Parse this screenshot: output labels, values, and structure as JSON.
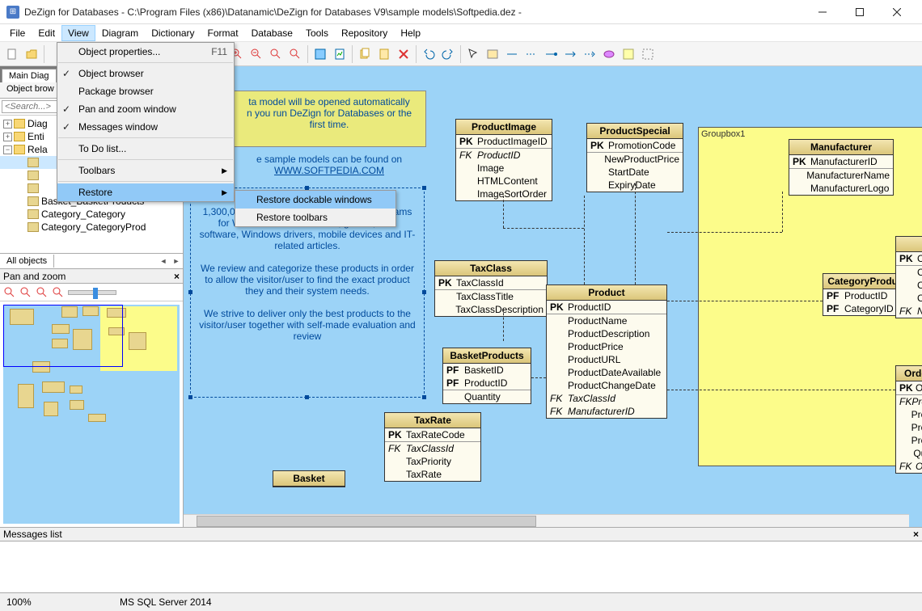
{
  "window": {
    "title": "DeZign for Databases - C:\\Program Files (x86)\\Datanamic\\DeZign for Databases V9\\sample models\\Softpedia.dez -"
  },
  "menubar": [
    "File",
    "Edit",
    "View",
    "Diagram",
    "Dictionary",
    "Format",
    "Database",
    "Tools",
    "Repository",
    "Help"
  ],
  "view_menu": {
    "object_properties": "Object properties...",
    "object_properties_key": "F11",
    "object_browser": "Object browser",
    "package_browser": "Package browser",
    "pan_zoom": "Pan and zoom window",
    "messages": "Messages window",
    "todo": "To Do list...",
    "toolbars": "Toolbars",
    "restore": "Restore"
  },
  "restore_submenu": {
    "dockable": "Restore dockable windows",
    "toolbars": "Restore toolbars"
  },
  "left": {
    "main_tab": "Main Diag",
    "object_browser_tab": "Object brow",
    "search_placeholder": "<Search...>",
    "tree": {
      "diagrams": "Diag",
      "entities": "Enti",
      "relationships": "Rela",
      "basket_products": "Basket_BasketProducts",
      "category_category": "Category_Category",
      "category_categoryprod": "Category_CategoryProd"
    },
    "all_objects": "All objects",
    "panzoom_title": "Pan and zoom"
  },
  "canvas": {
    "groupbox_label": "Groupbox1",
    "note_text": "ta model will be opened automatically\nn you run DeZign for Databases or the\nfirst time.",
    "note2_line1": "e sample models can be found on",
    "note2_line2": "WWW.SOFTPEDIA.COM",
    "desc_text": "Sof\n1,300,000 free and free-to-try software programs for Windows and Unix/Linux, games, Mac software, Windows drivers, mobile devices and IT-related articles.\n\nWe review and categorize these products in order to allow the visitor/user to find the exact product they and their system needs.\n\nWe strive to deliver only the best products to the visitor/user together with self-made evaluation and review",
    "entities": {
      "ProductImage": {
        "title": "ProductImage",
        "rows": [
          [
            "PK",
            "ProductImageID",
            ""
          ],
          [
            "FK",
            "ProductID",
            "i"
          ],
          [
            "",
            "Image",
            ""
          ],
          [
            "",
            "HTMLContent",
            ""
          ],
          [
            "",
            "ImageSortOrder",
            ""
          ]
        ]
      },
      "ProductSpecial": {
        "title": "ProductSpecial",
        "rows": [
          [
            "PK",
            "PromotionCode",
            ""
          ],
          [
            "",
            "NewProductPrice",
            ""
          ],
          [
            "",
            "StartDate",
            ""
          ],
          [
            "",
            "ExpiryDate",
            ""
          ]
        ]
      },
      "Manufacturer": {
        "title": "Manufacturer",
        "rows": [
          [
            "PK",
            "ManufacturerID",
            ""
          ],
          [
            "",
            "ManufacturerName",
            ""
          ],
          [
            "",
            "ManufacturerLogo",
            ""
          ]
        ]
      },
      "TaxClass": {
        "title": "TaxClass",
        "rows": [
          [
            "PK",
            "TaxClassId",
            ""
          ],
          [
            "",
            "TaxClassTitle",
            ""
          ],
          [
            "",
            "TaxClassDescription",
            ""
          ]
        ]
      },
      "Product": {
        "title": "Product",
        "rows": [
          [
            "PK",
            "ProductID",
            ""
          ],
          [
            "",
            "ProductName",
            ""
          ],
          [
            "",
            "ProductDescription",
            ""
          ],
          [
            "",
            "ProductPrice",
            ""
          ],
          [
            "",
            "ProductURL",
            ""
          ],
          [
            "",
            "ProductDateAvailable",
            ""
          ],
          [
            "",
            "ProductChangeDate",
            ""
          ],
          [
            "FK",
            "TaxClassId",
            "i"
          ],
          [
            "FK",
            "ManufacturerID",
            "i"
          ]
        ]
      },
      "CategoryProduct": {
        "title": "CategoryProduct",
        "rows": [
          [
            "PF",
            "ProductID",
            ""
          ],
          [
            "PF",
            "CategoryID",
            ""
          ]
        ]
      },
      "BasketProducts": {
        "title": "BasketProducts",
        "rows": [
          [
            "PF",
            "BasketID",
            ""
          ],
          [
            "PF",
            "ProductID",
            ""
          ],
          [
            "",
            "Quantity",
            ""
          ]
        ]
      },
      "TaxRate": {
        "title": "TaxRate",
        "rows": [
          [
            "PK",
            "TaxRateCode",
            ""
          ],
          [
            "FK",
            "TaxClassId",
            "i"
          ],
          [
            "",
            "TaxPriority",
            ""
          ],
          [
            "",
            "TaxRate",
            ""
          ]
        ]
      },
      "PartialRight": {
        "title": "",
        "rows": [
          [
            "PK",
            "C",
            ""
          ],
          [
            "",
            "C",
            ""
          ],
          [
            "",
            "C",
            ""
          ],
          [
            "",
            "C",
            ""
          ],
          [
            "FK",
            "N",
            ""
          ]
        ]
      },
      "Order": {
        "title": "Orde",
        "rows": [
          [
            "PK",
            "Ord",
            ""
          ],
          [
            "FK",
            "Prod",
            "i"
          ],
          [
            "",
            "Prod",
            ""
          ],
          [
            "",
            "Prod",
            ""
          ],
          [
            "",
            "Prod",
            ""
          ],
          [
            "",
            "Qua",
            ""
          ],
          [
            "FK",
            "Ord",
            "i"
          ]
        ]
      },
      "Basket": {
        "title": "Basket"
      }
    }
  },
  "messages": {
    "title": "Messages list"
  },
  "status": {
    "zoom": "100%",
    "db": "MS SQL Server 2014"
  }
}
